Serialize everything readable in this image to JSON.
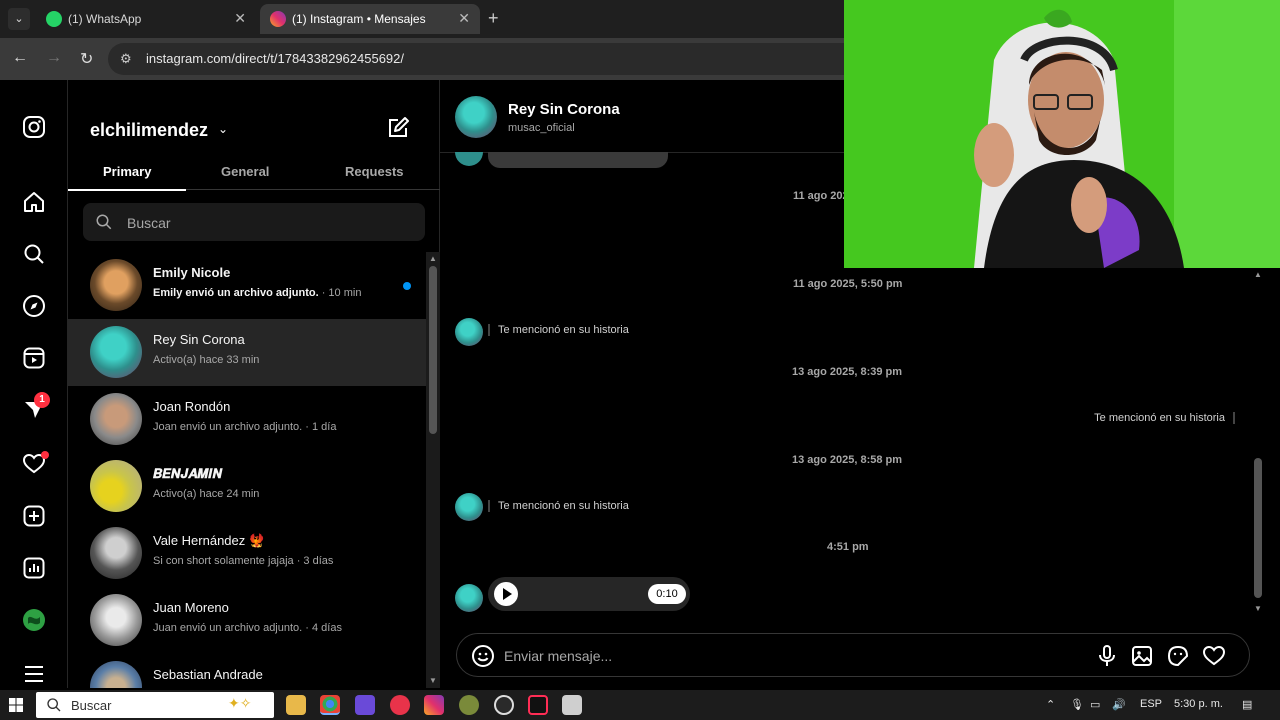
{
  "browser": {
    "tabs": [
      {
        "label": "(1) WhatsApp",
        "favicon": "whatsapp-icon",
        "color": "#25d366"
      },
      {
        "label": "(1) Instagram • Mensajes",
        "favicon": "instagram-icon",
        "color": "#e1306c"
      }
    ],
    "url": "instagram.com/direct/t/17843382962455692/"
  },
  "inbox": {
    "username": "elchilimendez",
    "tabs": [
      "Primary",
      "General",
      "Requests"
    ],
    "search_placeholder": "Buscar",
    "conversations": [
      {
        "name": "Emily Nicole",
        "preview": "Emily envió un archivo adjunto.",
        "time": " · 10 min",
        "unread": true,
        "avatar_color": "#6b4a2a"
      },
      {
        "name": "Rey Sin Corona",
        "preview": "Activo(a) hace 33 min",
        "time": "",
        "unread": false,
        "avatar_color": "#2e8f8c"
      },
      {
        "name": "Joan Rondón",
        "preview": "Joan envió un archivo adjunto.",
        "time": " · 1 día",
        "unread": false,
        "avatar_color": "#8a8a8a"
      },
      {
        "name": "𝑩𝑬𝑵𝑱𝑨𝑴𝑰𝑵",
        "preview": "Activo(a) hace 24 min",
        "time": "",
        "unread": false,
        "avatar_color": "#c9c54a"
      },
      {
        "name": "Vale Hernández 🐦‍🔥",
        "preview": "Si con short solamente jajaja",
        "time": " · 3 días",
        "unread": false,
        "avatar_color": "#555555"
      },
      {
        "name": "Juan Moreno",
        "preview": "Juan envió un archivo adjunto.",
        "time": " · 4 días",
        "unread": false,
        "avatar_color": "#999999"
      },
      {
        "name": "Sebastian Andrade",
        "preview": "",
        "time": "",
        "unread": false,
        "avatar_color": "#5a7ea8"
      }
    ]
  },
  "rail": {
    "messages_badge": "1"
  },
  "chat": {
    "name": "Rey Sin Corona",
    "handle": "musac_oficial",
    "timestamps": [
      "11 ago 2025",
      "11 ago 2025, 5:50 pm",
      "13 ago 2025, 8:39 pm",
      "13 ago 2025, 8:58 pm",
      "4:51 pm"
    ],
    "mentions": [
      "Te mencionó en su historia",
      "Te mencionó en su historia",
      "Te mencionó en su historia"
    ],
    "audio_duration": "0:10",
    "composer_placeholder": "Enviar mensaje..."
  },
  "taskbar": {
    "search_placeholder": "Buscar",
    "language": "ESP",
    "clock": "5:30 p. m."
  },
  "colors": {
    "accent_blue": "#0095f6",
    "notification_red": "#ff3040",
    "webcam_green": "#45c81f"
  }
}
